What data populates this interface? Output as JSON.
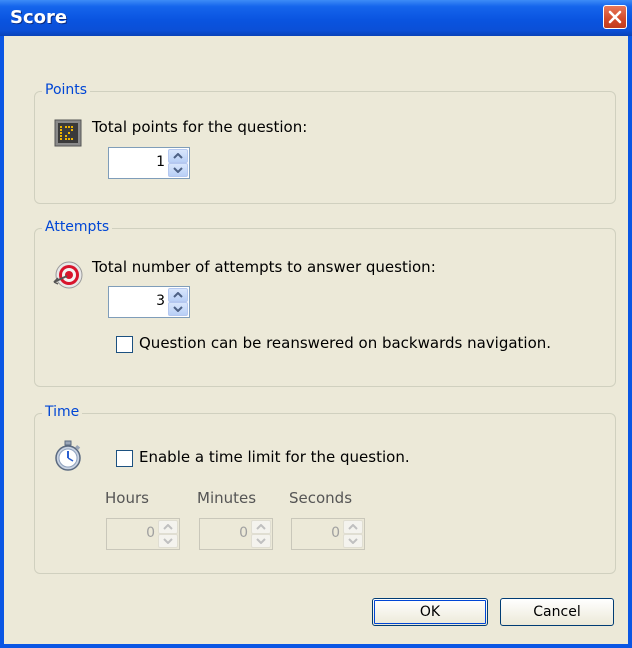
{
  "window": {
    "title": "Score"
  },
  "points": {
    "legend": "Points",
    "label": "Total points for the question:",
    "value": "1"
  },
  "attempts": {
    "legend": "Attempts",
    "label": "Total number of attempts to answer question:",
    "value": "3",
    "reanswer_label": "Question can be reanswered on backwards navigation.",
    "reanswer_checked": false
  },
  "time": {
    "legend": "Time",
    "enable_label": "Enable a time limit for the question.",
    "enable_checked": false,
    "hours_label": "Hours",
    "minutes_label": "Minutes",
    "seconds_label": "Seconds",
    "hours_value": "0",
    "minutes_value": "0",
    "seconds_value": "0"
  },
  "buttons": {
    "ok_label": "OK",
    "cancel_label": "Cancel"
  },
  "icons": {
    "points": "scoreboard-icon",
    "attempts": "target-icon",
    "time": "stopwatch-icon",
    "close": "close-icon"
  },
  "colors": {
    "titlebar": "#0a54e0",
    "legend": "#0046d5",
    "face": "#ece9d8"
  }
}
